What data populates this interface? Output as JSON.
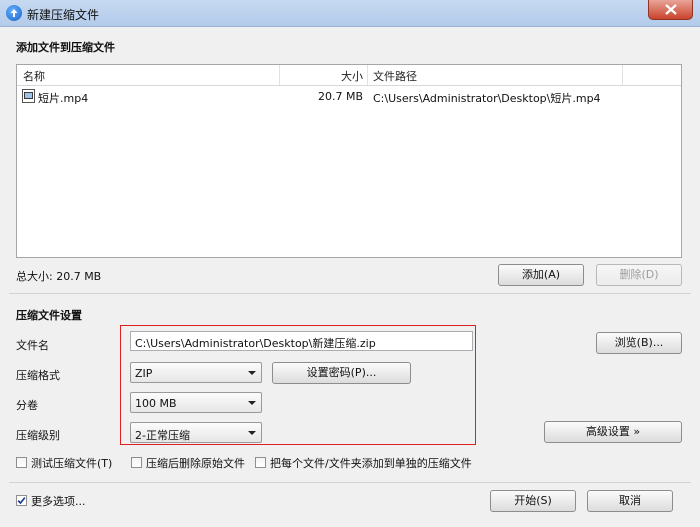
{
  "window": {
    "title": "新建压缩文件"
  },
  "add_section": {
    "heading": "添加文件到压缩文件",
    "columns": [
      "名称",
      "大小",
      "文件路径"
    ],
    "files": [
      {
        "name": "短片.mp4",
        "size": "20.7 MB",
        "path": "C:\\Users\\Administrator\\Desktop\\短片.mp4",
        "icon": "video-file-icon"
      }
    ],
    "total_size": "总大小: 20.7 MB",
    "add_button": "添加(A)",
    "delete_button": "删除(D)"
  },
  "settings": {
    "heading": "压缩文件设置",
    "filename_label": "文件名",
    "filename_value": "C:\\Users\\Administrator\\Desktop\\新建压缩.zip",
    "browse_button": "浏览(B)...",
    "format_label": "压缩格式",
    "format_value": "ZIP",
    "password_button": "设置密码(P)...",
    "volume_label": "分卷",
    "volume_value": "100 MB",
    "level_label": "压缩级别",
    "level_value": "2-正常压缩",
    "advanced_button": "高级设置 »",
    "options": [
      {
        "label": "测试压缩文件(T)",
        "checked": false
      },
      {
        "label": "压缩后删除原始文件",
        "checked": false
      },
      {
        "label": "把每个文件/文件夹添加到单独的压缩文件",
        "checked": false
      }
    ]
  },
  "footer": {
    "more_options": "更多选项...",
    "more_options_checked": true,
    "start_button": "开始(S)",
    "cancel_button": "取消"
  },
  "colors": {
    "highlight": "#e02020",
    "titlebar": "#b9cfee"
  }
}
